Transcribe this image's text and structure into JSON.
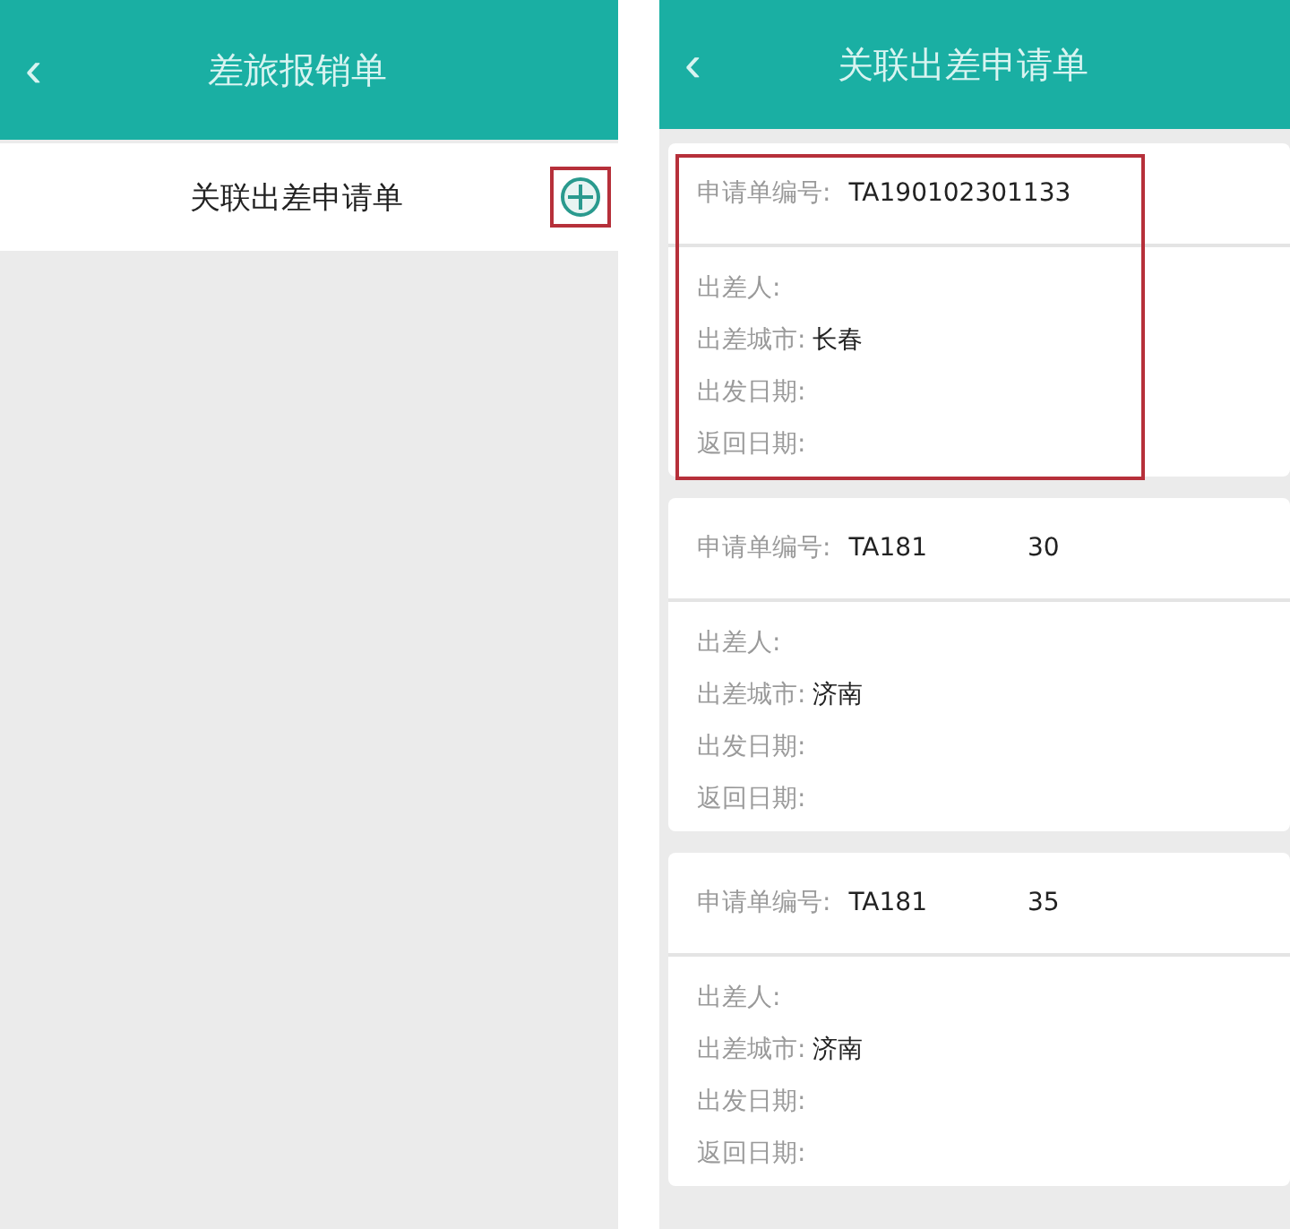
{
  "left_screen": {
    "header": {
      "back": "‹",
      "title": "差旅报销单"
    },
    "link_row": {
      "label": "关联出差申请单",
      "highlighted": true
    }
  },
  "right_screen": {
    "header": {
      "back": "‹",
      "title": "关联出差申请单"
    },
    "cards": [
      {
        "highlighted": true,
        "number_label": "申请单编号:",
        "number_parts": [
          "TA190102301133"
        ],
        "fields": [
          {
            "label": "出差人:"
          },
          {
            "label": "出差城市:",
            "value": "长春"
          },
          {
            "label": "出发日期:"
          },
          {
            "label": "返回日期:"
          }
        ]
      },
      {
        "highlighted": false,
        "number_label": "申请单编号:",
        "number_parts": [
          "TA181",
          "30"
        ],
        "fields": [
          {
            "label": "出差人:"
          },
          {
            "label": "出差城市:",
            "value": "济南"
          },
          {
            "label": "出发日期:"
          },
          {
            "label": "返回日期:"
          }
        ]
      },
      {
        "highlighted": false,
        "number_label": "申请单编号:",
        "number_parts": [
          "TA181",
          "35"
        ],
        "fields": [
          {
            "label": "出差人:"
          },
          {
            "label": "出差城市:",
            "value": "济南"
          },
          {
            "label": "出发日期:"
          },
          {
            "label": "返回日期:"
          }
        ]
      }
    ]
  }
}
